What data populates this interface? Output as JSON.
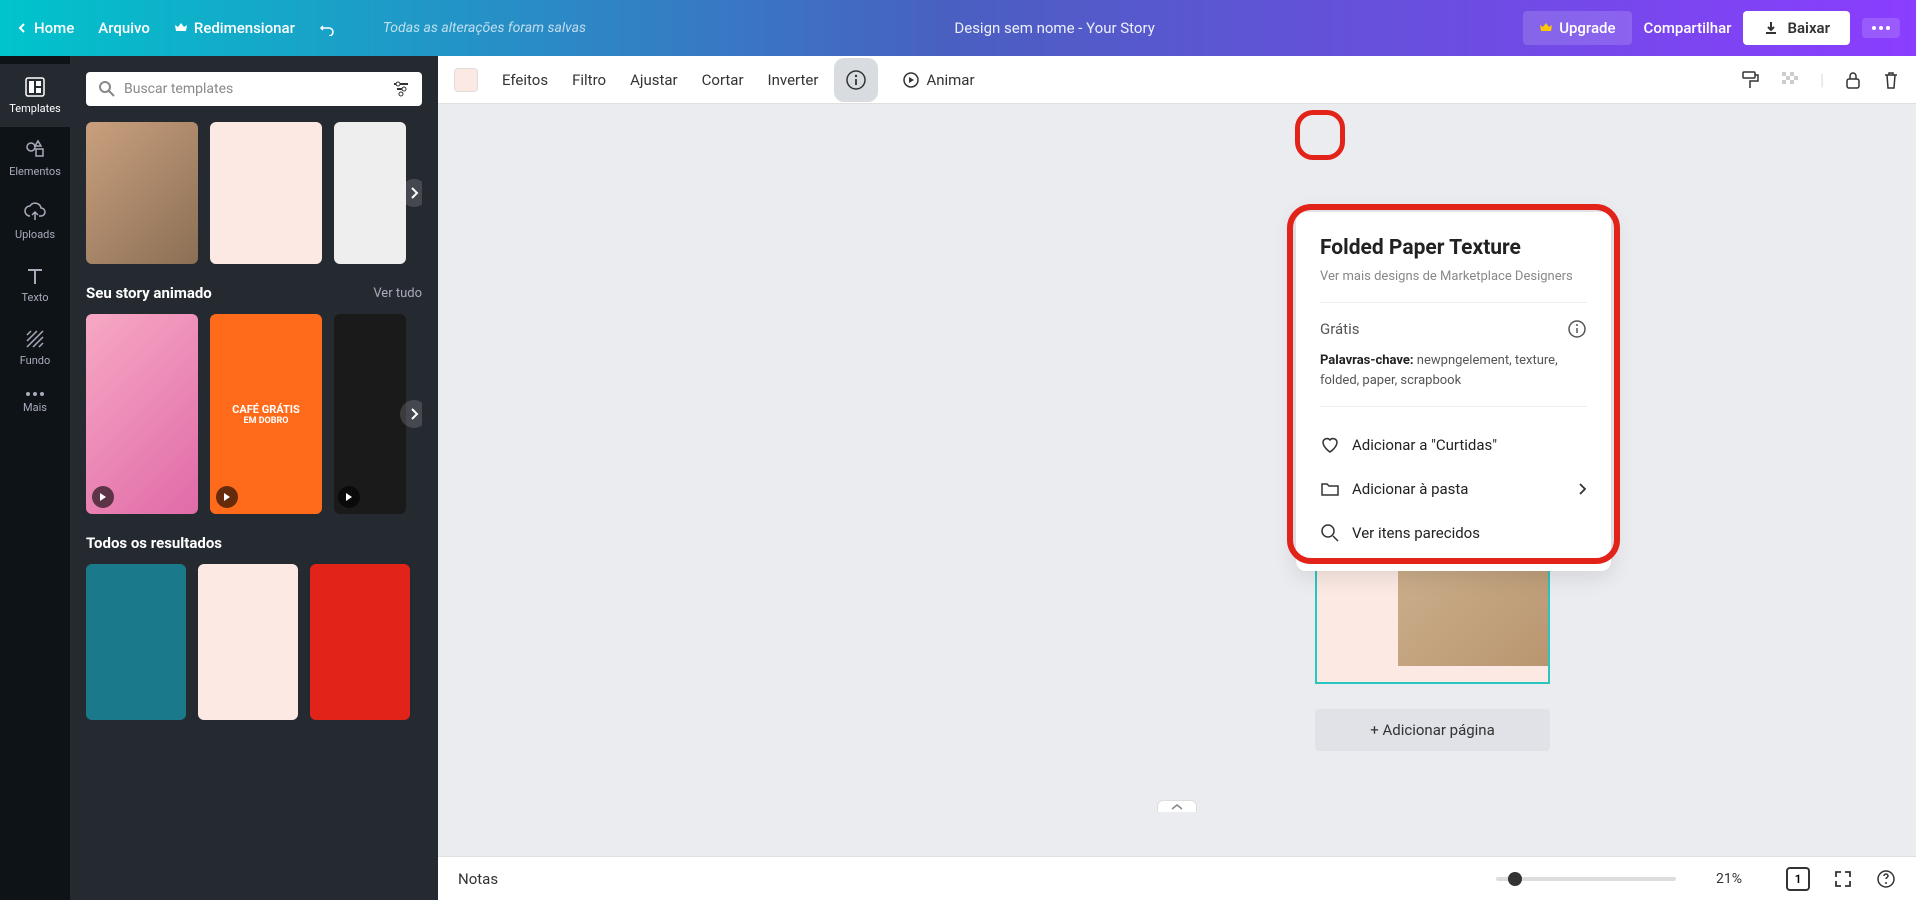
{
  "header": {
    "home": "Home",
    "file": "Arquivo",
    "resize": "Redimensionar",
    "status": "Todas as alterações foram salvas",
    "title": "Design sem nome - Your Story",
    "upgrade": "Upgrade",
    "share": "Compartilhar",
    "download": "Baixar"
  },
  "nav": {
    "templates": "Templates",
    "elements": "Elementos",
    "uploads": "Uploads",
    "text": "Texto",
    "background": "Fundo",
    "more": "Mais"
  },
  "panel": {
    "search_placeholder": "Buscar templates",
    "section_animated": "Seu story animado",
    "section_results": "Todos os resultados",
    "see_all": "Ver tudo"
  },
  "toolbar": {
    "effects": "Efeitos",
    "filter": "Filtro",
    "adjust": "Ajustar",
    "crop": "Cortar",
    "flip": "Inverter",
    "animate": "Animar",
    "swatch_color": "#fce9e3"
  },
  "popover": {
    "title": "Folded Paper Texture",
    "subtitle": "Ver mais designs de Marketplace Designers",
    "price": "Grátis",
    "keywords_label": "Palavras-chave:",
    "keywords_value": "newpngelement, texture, folded, paper, scrapbook",
    "action_like": "Adicionar a \"Curtidas\"",
    "action_folder": "Adicionar à pasta",
    "action_similar": "Ver itens parecidos"
  },
  "canvas": {
    "add_page": "+ Adicionar página"
  },
  "bottom": {
    "notes": "Notas",
    "zoom": "21%",
    "page_count": "1"
  }
}
